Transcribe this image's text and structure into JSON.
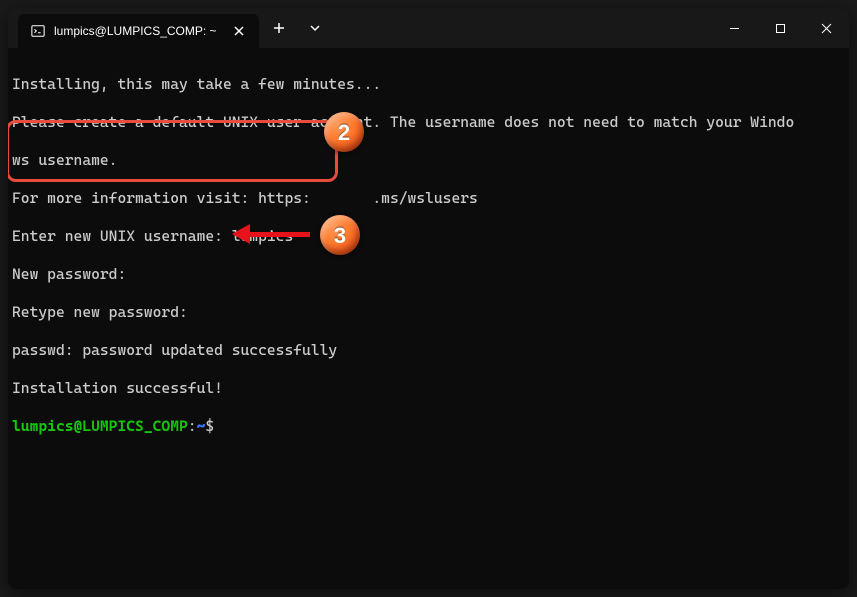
{
  "tab": {
    "title": "lumpics@LUMPICS_COMP: ~"
  },
  "terminal": {
    "line1": "Installing, this may take a few minutes...",
    "line2": "Please create a default UNIX user account. The username does not need to match your Windo",
    "line3": "ws username.",
    "line4a": "For more information visit: https:",
    "line4b": ".ms/wslusers",
    "line5": "Enter new UNIX username: lumpics",
    "line6": "New password:",
    "line7": "Retype new password:",
    "line8": "passwd: password updated successfully",
    "line9": "Installation successful!",
    "prompt_user": "lumpics@LUMPICS_COMP",
    "prompt_sep": ":",
    "prompt_path": "~",
    "prompt_dollar": "$"
  },
  "markers": {
    "m2": "2",
    "m3": "3"
  }
}
